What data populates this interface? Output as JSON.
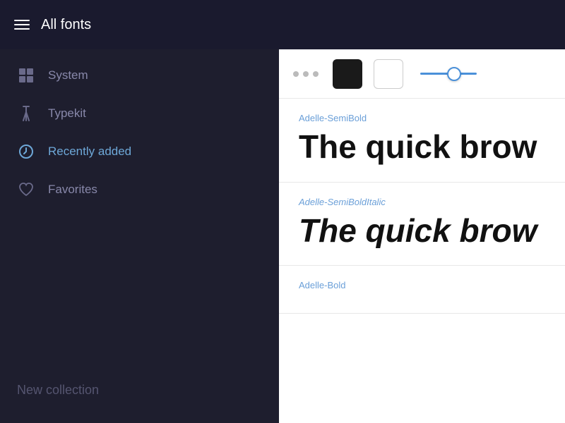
{
  "header": {
    "title": "All fonts",
    "menu_icon_label": "menu"
  },
  "sidebar": {
    "items": [
      {
        "id": "system",
        "label": "System",
        "icon": "system-icon"
      },
      {
        "id": "typekit",
        "label": "Typekit",
        "icon": "typekit-icon"
      },
      {
        "id": "recently-added",
        "label": "Recently added",
        "icon": "clock-icon",
        "active": true
      },
      {
        "id": "favorites",
        "label": "Favorites",
        "icon": "heart-icon"
      }
    ],
    "new_collection_label": "New collection"
  },
  "toolbar": {
    "dots_icon": "more-options-icon",
    "black_swatch_label": "black",
    "white_swatch_label": "white",
    "slider_label": "size-slider"
  },
  "fonts": [
    {
      "name": "Adelle-SemiBold",
      "preview": "The quick brow",
      "style": "semibold",
      "name_italic": false
    },
    {
      "name": "Adelle-SemiBoldItalic",
      "preview": "The quick brow",
      "style": "semibold-italic",
      "name_italic": true
    },
    {
      "name": "Adelle-Bold",
      "preview": "",
      "style": "bold",
      "name_italic": false
    }
  ],
  "colors": {
    "sidebar_bg": "#1e1e2e",
    "header_bg": "#1a1a2e",
    "active_color": "#6ea8d8",
    "accent_blue": "#4a90d9"
  }
}
